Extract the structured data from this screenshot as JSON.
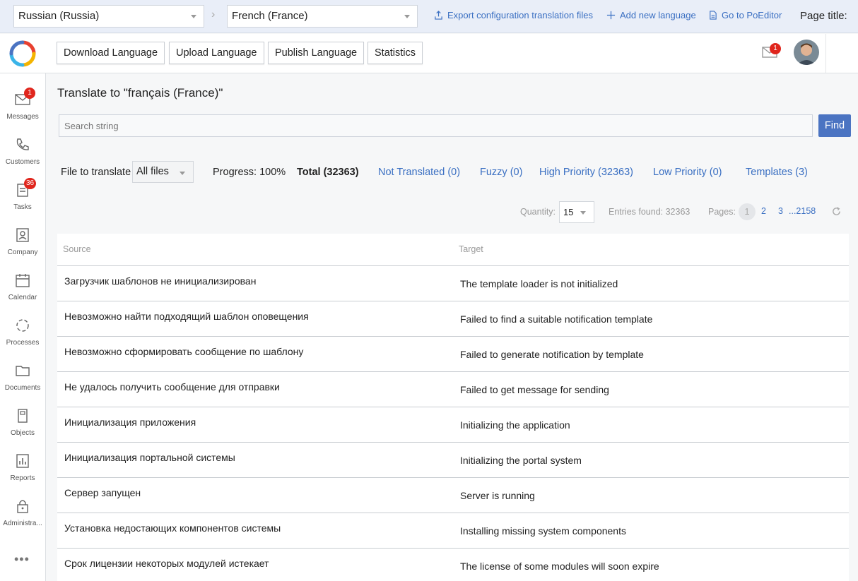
{
  "topbar": {
    "source_language": "Russian (Russia)",
    "target_language": "French (France)",
    "export_label": "Export configuration translation files",
    "add_language_label": "Add new language",
    "poeditor_label": "Go to PoEditor",
    "page_title_label": "Page title:"
  },
  "header": {
    "buttons": [
      "Download Language",
      "Upload Language",
      "Publish Language",
      "Statistics"
    ],
    "mail_badge": "1"
  },
  "sidebar": {
    "items": [
      {
        "label": "Messages",
        "icon": "envelope-icon",
        "badge": "1"
      },
      {
        "label": "Customers",
        "icon": "phone-icon"
      },
      {
        "label": "Tasks",
        "icon": "clipboard-icon",
        "badge": "36"
      },
      {
        "label": "Company",
        "icon": "id-card-icon"
      },
      {
        "label": "Calendar",
        "icon": "calendar-icon"
      },
      {
        "label": "Processes",
        "icon": "cycle-icon"
      },
      {
        "label": "Documents",
        "icon": "folder-icon"
      },
      {
        "label": "Objects",
        "icon": "cube-icon"
      },
      {
        "label": "Reports",
        "icon": "bar-chart-icon"
      },
      {
        "label": "Administra...",
        "icon": "lock-icon"
      }
    ],
    "more": "•••"
  },
  "main": {
    "title": "Translate to \"français (France)\"",
    "search_placeholder": "Search string",
    "find_label": "Find",
    "file_label": "File to translate",
    "file_value": "All files",
    "progress": "Progress: 100%",
    "total": "Total (32363)",
    "filters": [
      "Not Translated (0)",
      "Fuzzy (0)",
      "High Priority (32363)",
      "Low Priority (0)",
      "Templates (3)"
    ],
    "quantity_label": "Quantity:",
    "quantity_value": "15",
    "entries_found": "Entries found: 32363",
    "pages_label": "Pages:",
    "pages": [
      "1",
      "2",
      "3",
      "...2158"
    ]
  },
  "table": {
    "headers": {
      "source": "Source",
      "target": "Target"
    },
    "rows": [
      {
        "source": "Загрузчик шаблонов не инициализирован",
        "target": "The template loader is not initialized"
      },
      {
        "source": "Невозможно найти подходящий шаблон оповещения",
        "target": "Failed to find a suitable notification template"
      },
      {
        "source": "Невозможно сформировать сообщение по шаблону",
        "target": "Failed to generate notification by template"
      },
      {
        "source": "Не удалось получить сообщение для отправки",
        "target": "Failed to get message for sending"
      },
      {
        "source": "Инициализация приложения",
        "target": "Initializing the application"
      },
      {
        "source": "Инициализация портальной системы",
        "target": "Initializing the portal system"
      },
      {
        "source": "Сервер запущен",
        "target": "Server is running"
      },
      {
        "source": "Установка недостающих компонентов системы",
        "target": "Installing missing system components"
      },
      {
        "source": "Срок лицензии некоторых модулей истекает",
        "target": "The license of some modules will soon expire"
      }
    ]
  },
  "colors": {
    "accent": "#4b74c2",
    "link": "#3a6fc2",
    "badge": "#e0261d"
  }
}
